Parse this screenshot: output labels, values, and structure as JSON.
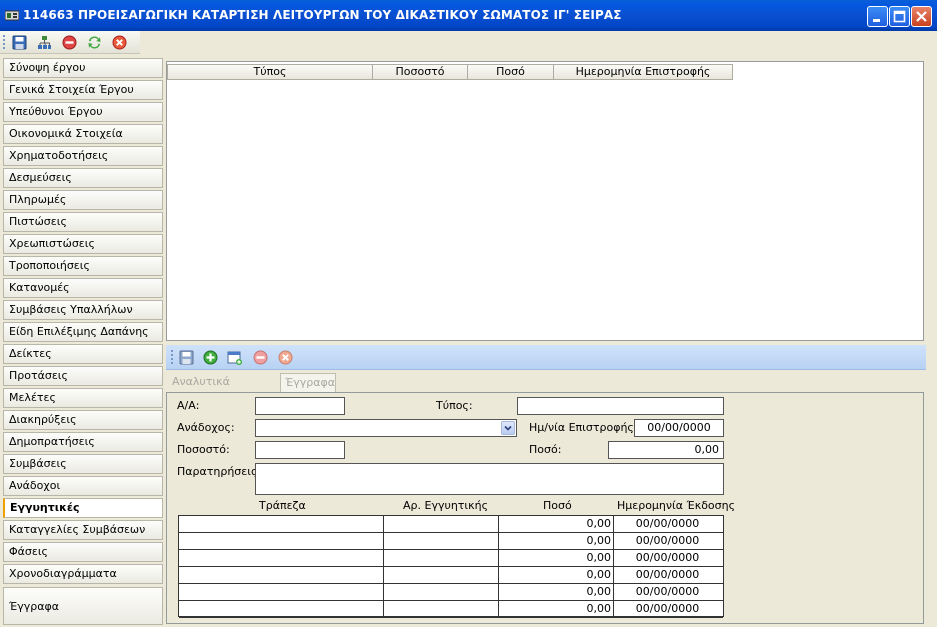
{
  "window": {
    "title": "114663 ΠΡΟΕΙΣΑΓΩΓΙΚΗ ΚΑΤΑΡΤΙΣΗ ΛΕΙΤΟΥΡΓΩΝ ΤΟΥ ΔΙΚΑΣΤΙΚΟΥ ΣΩΜΑΤΟΣ ΙΓ' ΣΕΙΡΑΣ",
    "icon": "app-icon",
    "controls": [
      "minimize-icon",
      "maximize-icon",
      "close-icon"
    ]
  },
  "main_toolbar": {
    "icons": [
      "save-icon",
      "hierarchy-icon",
      "delete-icon",
      "refresh-icon",
      "cancel-icon"
    ]
  },
  "nav": {
    "items": [
      "Σύνοψη έργου",
      "Γενικά Στοιχεία Έργου",
      "Υπεύθυνοι Έργου",
      "Οικονομικά Στοιχεία",
      "Χρηματοδοτήσεις",
      "Δεσμεύσεις",
      "Πληρωμές",
      "Πιστώσεις",
      "Χρεωπιστώσεις",
      "Τροποποιήσεις",
      "Κατανομές",
      "Συμβάσεις Υπαλλήλων",
      "Είδη Επιλέξιμης Δαπάνης",
      "Δείκτες",
      "Προτάσεις",
      "Μελέτες",
      "Διακηρύξεις",
      "Δημοπρατήσεις",
      "Συμβάσεις",
      "Ανάδοχοι",
      "Εγγυητικές",
      "Καταγγελίες Συμβάσεων",
      "Φάσεις",
      "Χρονοδιαγράμματα"
    ],
    "active": "Εγγυητικές",
    "documents": "Έγγραφα"
  },
  "top_grid": {
    "columns": [
      "Τύπος",
      "Ποσοστό",
      "Ποσό",
      "Ημερομηνία Επιστροφής"
    ]
  },
  "detail_toolbar": {
    "icons": [
      "save-icon",
      "add-icon",
      "new-window-icon",
      "remove-icon",
      "cancel-icon"
    ]
  },
  "tabs": [
    "Αναλυτικά Στοιχεία",
    "Έγγραφα"
  ],
  "form": {
    "aa_label": "Α/Α:",
    "aa_value": "",
    "type_label": "Τύπος:",
    "type_value": "",
    "contractor_label": "Ανάδοχος:",
    "contractor_value": "",
    "return_date_label": "Ημ/νία Επιστροφής:",
    "return_date_value": "00/00/0000",
    "percent_label": "Ποσοστό:",
    "percent_value": "",
    "amount_label": "Ποσό:",
    "amount_value": "0,00",
    "remarks_label": "Παρατηρήσεις:",
    "remarks_value": ""
  },
  "guarantees_table": {
    "columns": [
      "Τράπεζα",
      "Αρ. Εγγυητικής",
      "Ποσό",
      "Ημερομηνία Έκδοσης"
    ],
    "rows": [
      [
        "",
        "",
        "0,00",
        "00/00/0000"
      ],
      [
        "",
        "",
        "0,00",
        "00/00/0000"
      ],
      [
        "",
        "",
        "0,00",
        "00/00/0000"
      ],
      [
        "",
        "",
        "0,00",
        "00/00/0000"
      ],
      [
        "",
        "",
        "0,00",
        "00/00/0000"
      ],
      [
        "",
        "",
        "0,00",
        "00/00/0000"
      ]
    ]
  }
}
